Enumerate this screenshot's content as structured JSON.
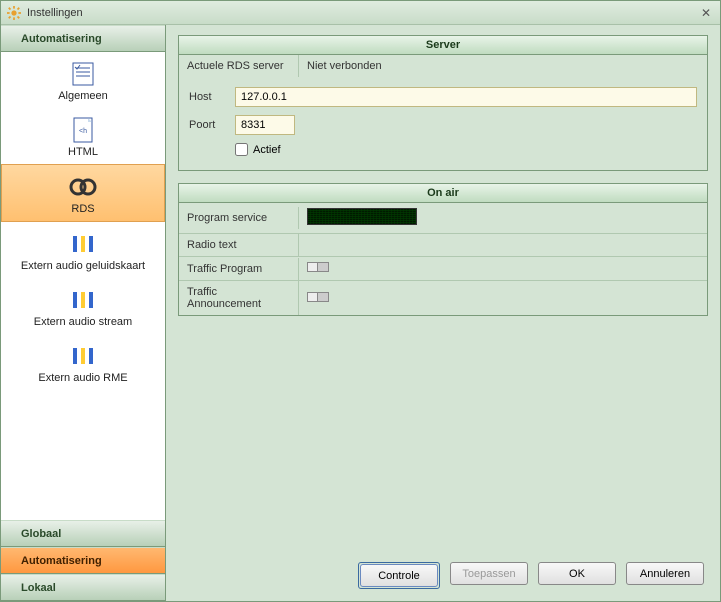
{
  "window": {
    "title": "Instellingen"
  },
  "sidebar": {
    "headers": {
      "globaal": "Globaal",
      "automatisering": "Automatisering",
      "lokaal": "Lokaal"
    },
    "items": [
      {
        "label": "Algemeen"
      },
      {
        "label": "HTML"
      },
      {
        "label": "RDS"
      },
      {
        "label": "Extern audio geluidskaart"
      },
      {
        "label": "Extern audio stream"
      },
      {
        "label": "Extern audio RME"
      }
    ]
  },
  "server": {
    "title": "Server",
    "status_label": "Actuele RDS server",
    "status_value": "Niet verbonden",
    "host_label": "Host",
    "host_value": "127.0.0.1",
    "port_label": "Poort",
    "port_value": "8331",
    "active_label": "Actief",
    "active_checked": false
  },
  "onair": {
    "title": "On air",
    "rows": {
      "program_service": "Program service",
      "radio_text": "Radio text",
      "traffic_program": "Traffic Program",
      "traffic_announcement": "Traffic Announcement"
    },
    "radio_text_value": "",
    "traffic_program_on": false,
    "traffic_announcement_on": false
  },
  "buttons": {
    "controle": "Controle",
    "toepassen": "Toepassen",
    "ok": "OK",
    "annuleren": "Annuleren"
  }
}
